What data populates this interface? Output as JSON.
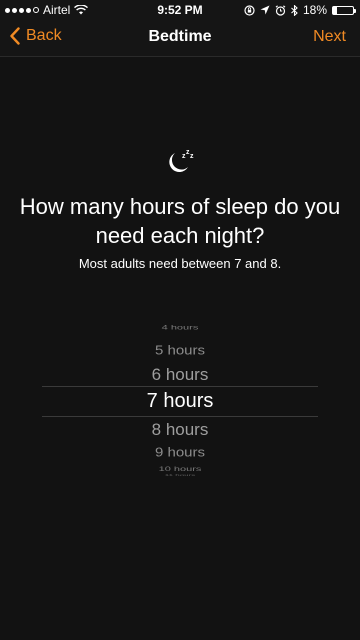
{
  "status_bar": {
    "carrier": "Airtel",
    "time": "9:52 PM",
    "battery": "18%",
    "battery_level": 0.18
  },
  "nav": {
    "back_label": "Back",
    "title": "Bedtime",
    "next_label": "Next"
  },
  "content": {
    "question": "How many hours of sleep do you need each night?",
    "subtitle": "Most adults need between 7 and 8."
  },
  "picker": {
    "items": [
      "4 hours",
      "5 hours",
      "6 hours",
      "7 hours",
      "8 hours",
      "9 hours",
      "10 hours",
      "11 hours"
    ],
    "selected": "7 hours"
  },
  "colors": {
    "accent": "#f08a24",
    "background": "#121212"
  },
  "icons": {
    "sleep": "moon-zzz-icon",
    "back": "chevron-left-icon",
    "wifi": "wifi-icon",
    "location": "location-arrow-icon",
    "alarm": "alarm-icon",
    "bluetooth": "bluetooth-icon",
    "lock": "rotation-lock-icon"
  }
}
